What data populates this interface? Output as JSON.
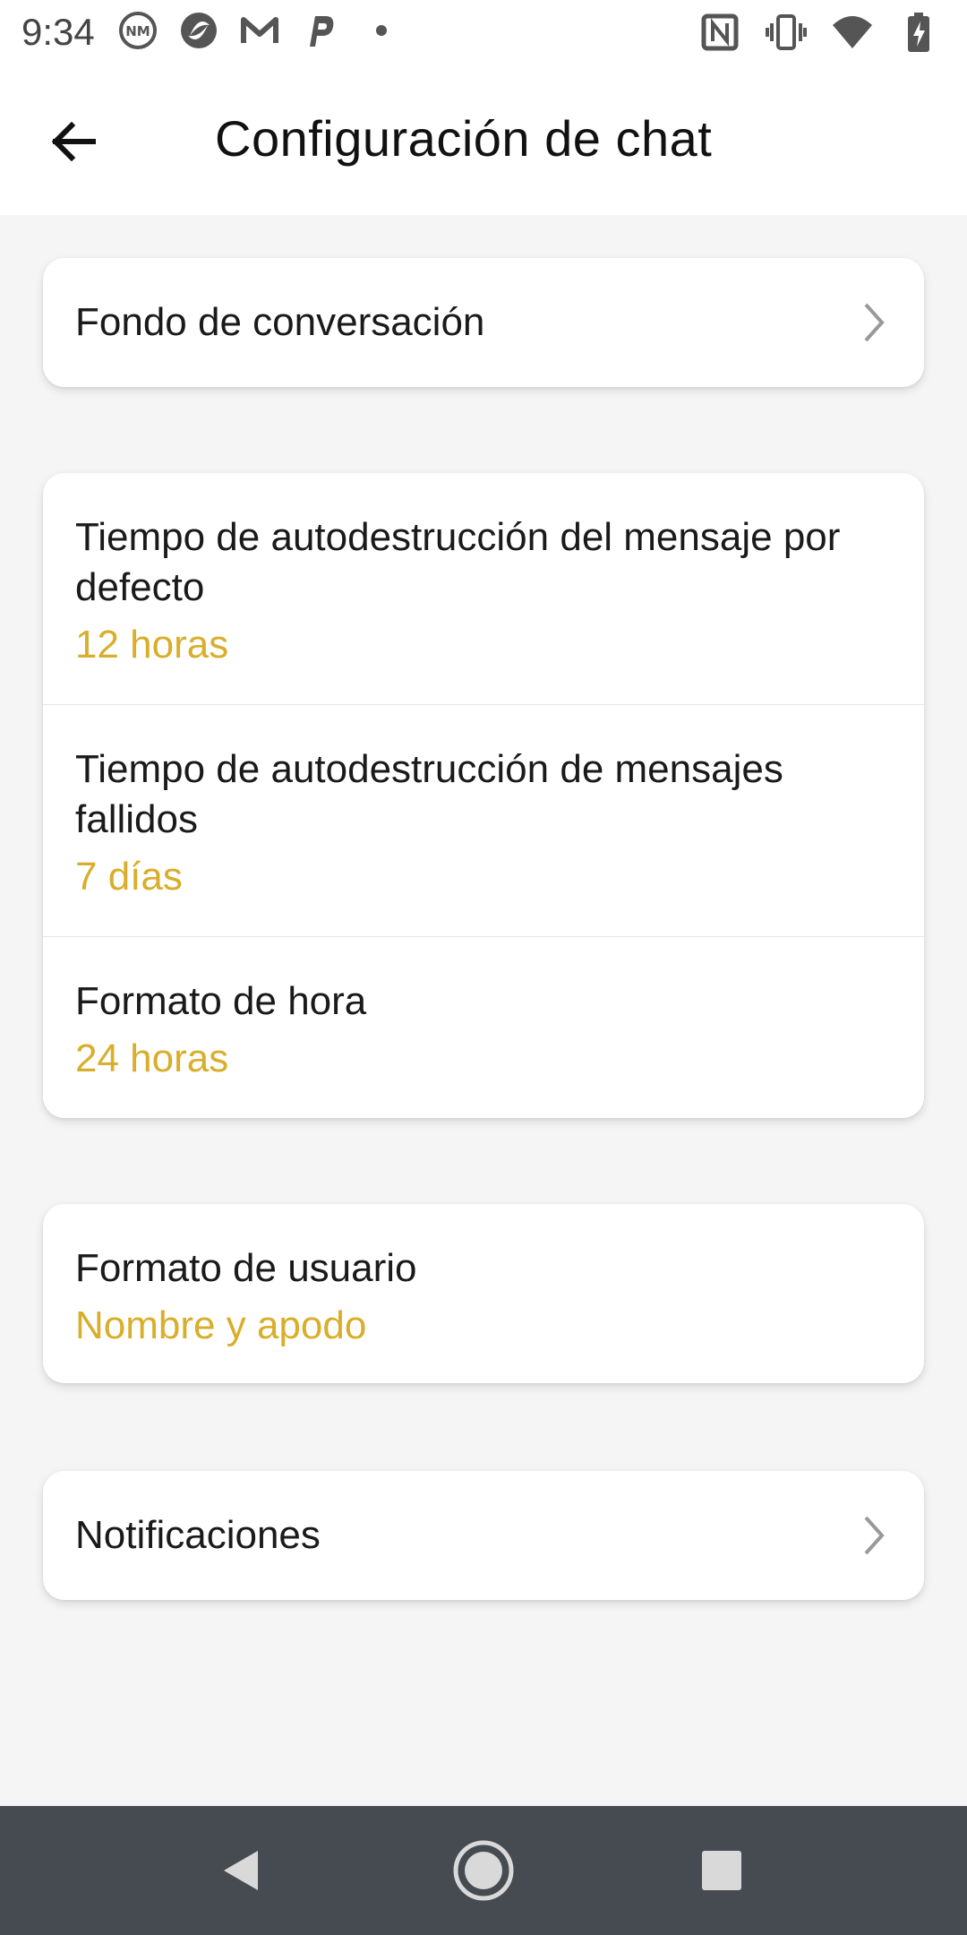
{
  "status_bar": {
    "time": "9:34",
    "left_icons": [
      "news-icon",
      "camera-app-icon",
      "gmail-icon",
      "parking-icon",
      "dot-icon"
    ],
    "right_icons": [
      "nfc-icon",
      "vibrate-icon",
      "wifi-icon",
      "battery-icon"
    ]
  },
  "app_bar": {
    "title": "Configuración de chat"
  },
  "cards": {
    "background": {
      "label": "Fondo de conversación"
    },
    "self_destruct": {
      "default": {
        "label": "Tiempo de autodestrucción del mensaje por defecto",
        "value": "12 horas"
      },
      "failed": {
        "label": "Tiempo de autodestrucción de mensajes fallidos",
        "value": "7 días"
      },
      "time_format": {
        "label": "Formato de hora",
        "value": "24 horas"
      }
    },
    "user_format": {
      "label": "Formato de usuario",
      "value": "Nombre y apodo"
    },
    "notifications": {
      "label": "Notificaciones"
    }
  },
  "colors": {
    "accent": "#d8ae2a",
    "nav_bar": "#454b51",
    "background": "#f5f5f5"
  }
}
